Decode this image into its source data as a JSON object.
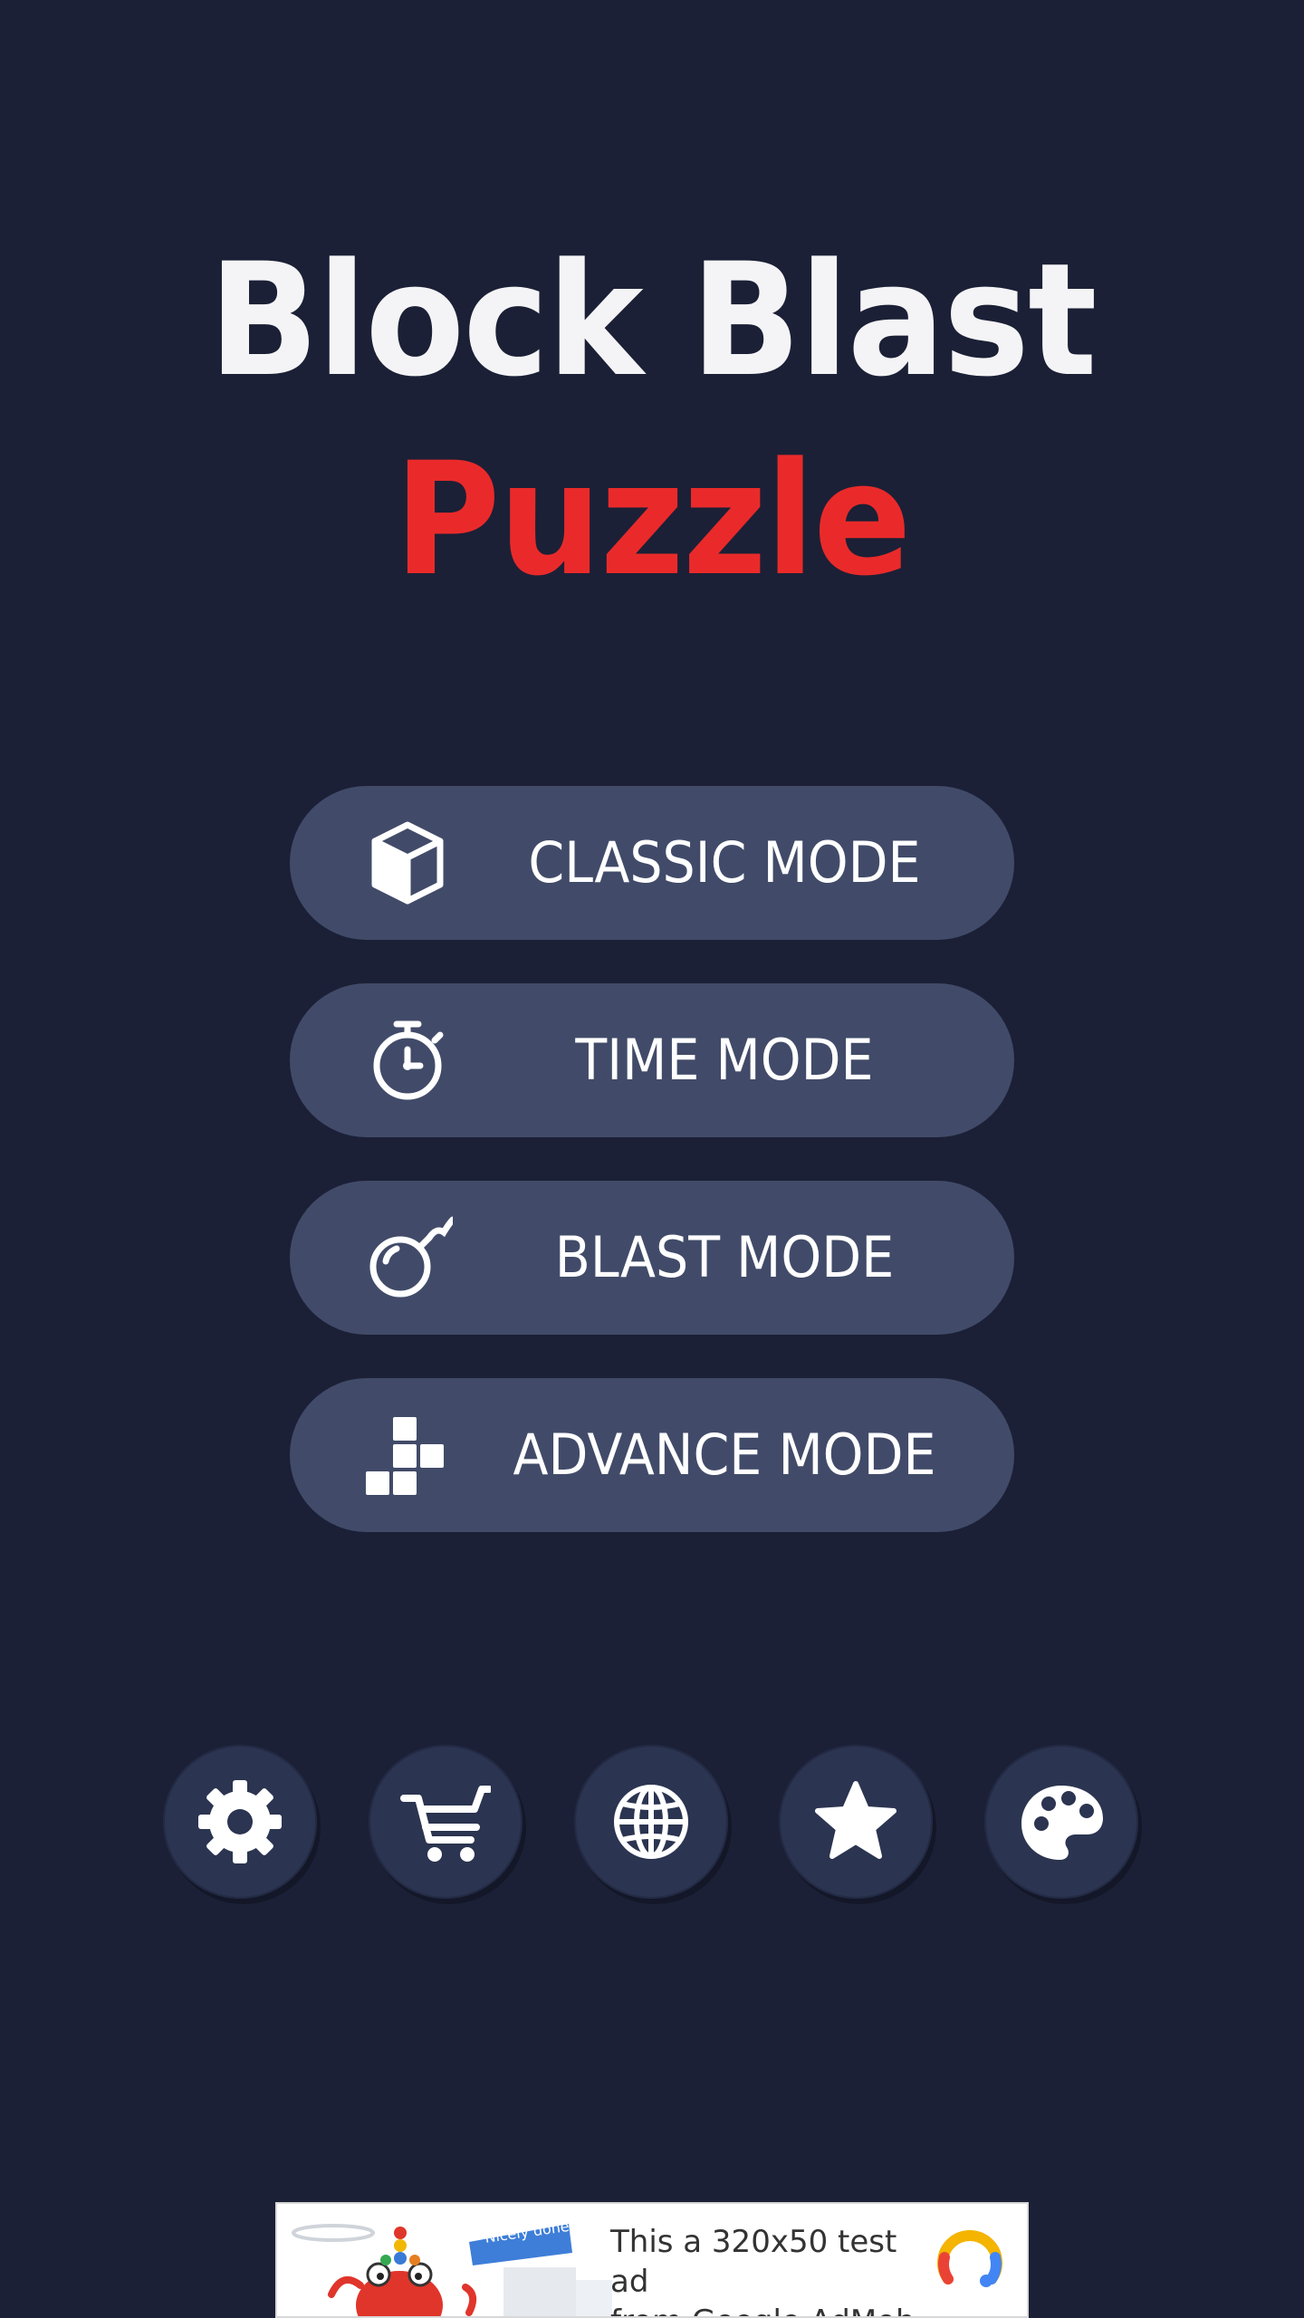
{
  "title": {
    "line1": "Block Blast",
    "line2": "Puzzle"
  },
  "modes": [
    {
      "label": "CLASSIC MODE",
      "icon": "cube-icon"
    },
    {
      "label": "TIME MODE",
      "icon": "stopwatch-icon"
    },
    {
      "label": "BLAST MODE",
      "icon": "bomb-icon"
    },
    {
      "label": "ADVANCE MODE",
      "icon": "blocks-icon"
    }
  ],
  "toolbar": [
    {
      "icon": "gear-icon"
    },
    {
      "icon": "cart-icon"
    },
    {
      "icon": "globe-icon"
    },
    {
      "icon": "star-icon"
    },
    {
      "icon": "palette-icon"
    }
  ],
  "ad": {
    "badge": "Nicely done!",
    "line1": "This a 320x50 test ad",
    "line2": "from Google AdMob."
  },
  "colors": {
    "background": "#1b2036",
    "button": "#414b69",
    "title_accent": "#ea2a2a"
  }
}
